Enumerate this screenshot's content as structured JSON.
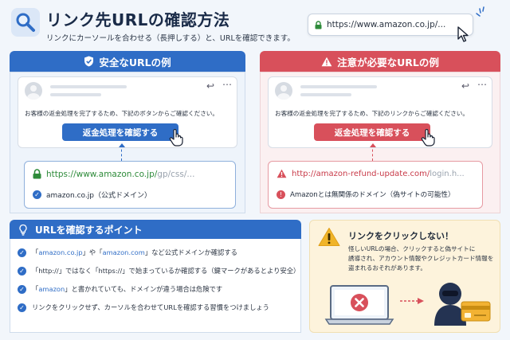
{
  "header": {
    "title": "リンク先URLの確認方法",
    "subtitle": "リンクにカーソールを合わせる（長押しする）と、URLを確認できます。",
    "url_bar_text": "https://www.amazon.co.jp/..."
  },
  "safe": {
    "heading": "安全なURLの例",
    "email_message": "お客様の返金処理を完了するため、下記のボタンからご確認ください。",
    "button_label": "返金処理を確認する",
    "url_main": "https://www.amazon.co.jp/",
    "url_rest": "gp/css/...",
    "domain_note": "amazon.co.jp（公式ドメイン）"
  },
  "warning": {
    "heading": "注意が必要なURLの例",
    "email_message": "お客様の返金処理を完了するため、下記のリンクからご確認ください。",
    "button_label": "返金処理を確認する",
    "url_main": "http://amazon-refund-update.com/",
    "url_rest": "login.h...",
    "domain_note": "Amazonとは無関係のドメイン（偽サイトの可能性）"
  },
  "tips": {
    "heading": "URLを確認するポイント",
    "items": [
      {
        "pre": "「",
        "hl1": "amazon.co.jp",
        "mid": "」や「",
        "hl2": "amazon.com",
        "post": "」など公式ドメインか確認する"
      },
      {
        "pre": "「http://」ではなく「https://」で始まっているか確認する（鍵マークがあるとより安全）"
      },
      {
        "pre": "「",
        "hl1": "amazon",
        "post": "」と書かれていても、ドメインが違う場合は危険です"
      },
      {
        "pre": "リンクをクリックせず、カーソルを合わせてURLを確認する習慣をつけましょう"
      }
    ]
  },
  "alert": {
    "heading": "リンクをクリックしない！",
    "body_lines": [
      "怪しいURLの場合、クリックすると偽サイトに",
      "誘導され、アカウント情報やクレジットカード情報を",
      "盗まれるおそれがあります。"
    ]
  },
  "colors": {
    "safe": "#2f6dc6",
    "danger": "#d8505b",
    "lock_green": "#2e8b3a"
  }
}
